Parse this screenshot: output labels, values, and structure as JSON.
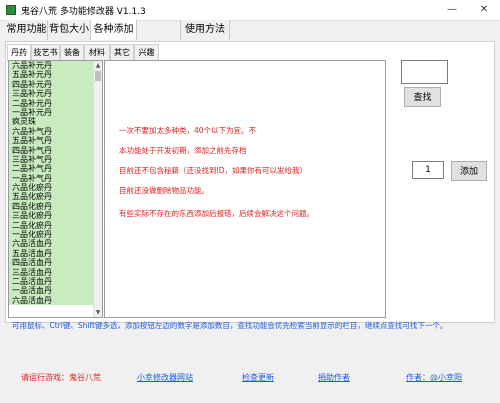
{
  "window": {
    "title": "鬼谷八荒 多功能修改器 V1.1.3",
    "minimize": "—",
    "close": "✕"
  },
  "main_tabs": [
    "常用功能",
    "背包大小",
    "各种添加",
    "使用方法"
  ],
  "sub_tabs": [
    "丹药",
    "技艺书",
    "装备",
    "材料",
    "其它",
    "兴趣"
  ],
  "items": [
    "六品补元丹",
    "五品补元丹",
    "四品补元丹",
    "三品补元丹",
    "二品补元丹",
    "一品补元丹",
    "疯灵珠",
    "六品补气丹",
    "五品补气丹",
    "四品补气丹",
    "三品补气丹",
    "二品补气丹",
    "一品补气丹",
    "六品化瘀丹",
    "五品化瘀丹",
    "四品化瘀丹",
    "三品化瘀丹",
    "二品化瘀丹",
    "一品化瘀丹",
    "六品活血丹",
    "五品活血丹",
    "四品活血丹",
    "三品活血丹",
    "二品活血丹",
    "一品活血丹",
    "六品活血丹"
  ],
  "notes": [
    "一次不要加太多种类，40个以下为宜。不",
    "本功能处于开发初期，添加之前先存档",
    "目前还不包含秘籍（还没找到ID，如果你有可以发给我）",
    "目前还没做删除物品功能。",
    "有些实际不存在的东西添加后报错，后续会解决这个问题。"
  ],
  "search": {
    "value": "",
    "button": "查找"
  },
  "add": {
    "quantity": "1",
    "button": "添加"
  },
  "hint": "可用鼠标、Ctrl键、Shift键多选，添加按钮左边的数字是添加数目，查找功能会优先检索当前显示的栏目，继续点查找可找下一个。",
  "footer": {
    "game_label": "请运行游戏：",
    "game_name": "鬼谷八荒",
    "site_link": "小幸修改器网站",
    "update_link": "检查更新",
    "donate_link": "捐助作者",
    "author_link": "作者：@小幸阳"
  },
  "colors": {
    "list_highlight": "#c8ebc0",
    "note_red": "#e02020",
    "link_blue": "#1e5bd8"
  }
}
